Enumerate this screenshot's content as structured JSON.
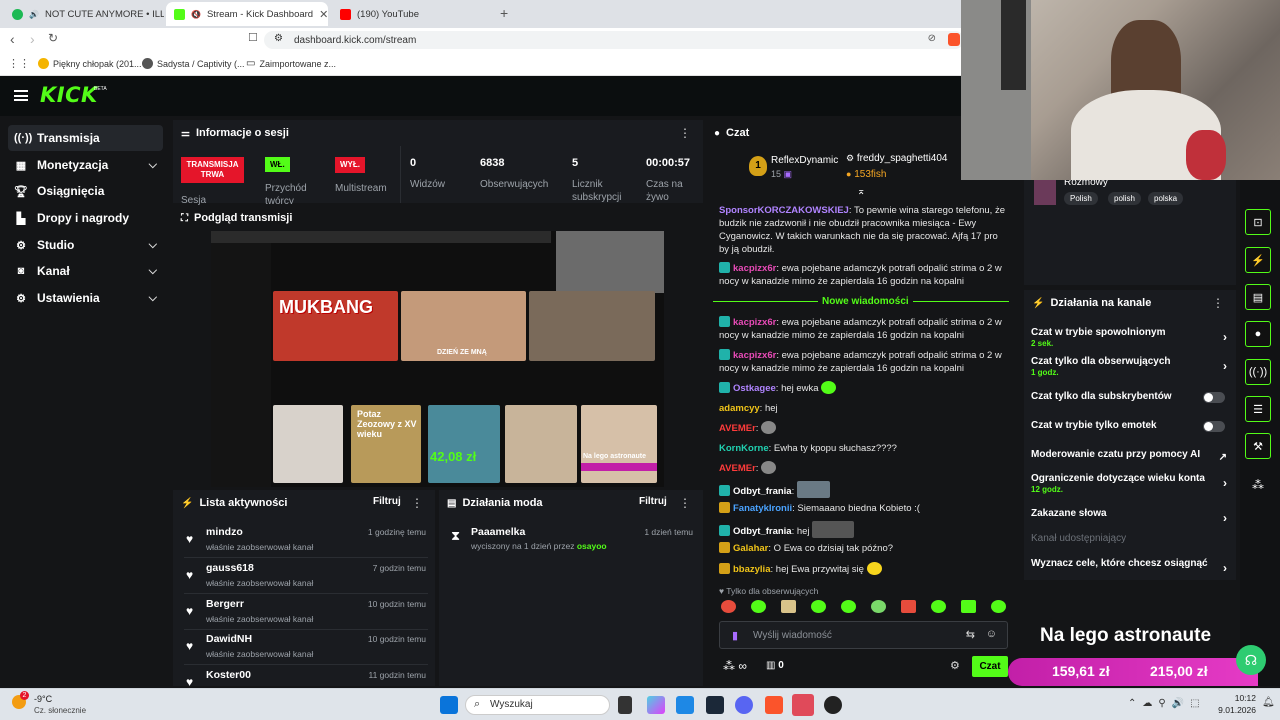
{
  "browser": {
    "tabs": [
      {
        "label": "NOT CUTE ANYMORE • ILLIT"
      },
      {
        "label": "Stream - Kick Dashboard"
      },
      {
        "label": "(190) YouTube"
      }
    ],
    "url": "dashboard.kick.com/stream",
    "bookmarks": [
      "Piękny chłopak (201...",
      "Sadysta / Captivity (...",
      "Zaimportowane z..."
    ]
  },
  "sidebar": {
    "items": [
      {
        "label": "Transmisja",
        "icon": "broadcast-icon",
        "chevron": false
      },
      {
        "label": "Monetyzacja",
        "icon": "dollar-icon",
        "chevron": true
      },
      {
        "label": "Osiągnięcia",
        "icon": "trophy-icon",
        "chevron": false
      },
      {
        "label": "Dropy i nagrody",
        "icon": "gift-icon",
        "chevron": false
      },
      {
        "label": "Studio",
        "icon": "gear-icon",
        "chevron": true
      },
      {
        "label": "Kanał",
        "icon": "channel-icon",
        "chevron": true
      },
      {
        "label": "Ustawienia",
        "icon": "settings-icon",
        "chevron": true
      }
    ]
  },
  "session": {
    "title": "Informacje o sesji",
    "badge_live": "TRANSMISJA TRWA",
    "label_session": "Sesja",
    "badge_on": "WŁ.",
    "label_transcode": "Przychód twórcy",
    "badge_off": "WYŁ.",
    "label_multistream": "Multistream",
    "viewers": "0",
    "label_viewers": "Widzów",
    "followers": "6838",
    "label_followers": "Obserwujących",
    "subs": "5",
    "label_subs": "Licznik subskrypcji",
    "uptime": "00:00:57",
    "label_uptime": "Czas na żywo"
  },
  "preview": {
    "title": "Podgląd transmisji",
    "overlay_price": "42,08 zł",
    "overlay_name": "Na lego astronaute",
    "thumb_text1": "MUKBANG",
    "thumb_text2": "DZIEŃ ZE MNĄ",
    "thumb_text3": "Potaz Zeozowy z XV wieku"
  },
  "activity": {
    "title": "Lista aktywności",
    "filter": "Filtruj",
    "rows": [
      {
        "name": "mindzo",
        "sub": "właśnie zaobserwował kanał",
        "time": "1 godzinę temu"
      },
      {
        "name": "gauss618",
        "sub": "właśnie zaobserwował kanał",
        "time": "7 godzin temu"
      },
      {
        "name": "Bergerr",
        "sub": "właśnie zaobserwował kanał",
        "time": "10 godzin temu"
      },
      {
        "name": "DawidNH",
        "sub": "właśnie zaobserwował kanał",
        "time": "10 godzin temu"
      },
      {
        "name": "Koster00",
        "sub": "",
        "time": "11 godzin temu"
      }
    ]
  },
  "modactions": {
    "title": "Działania moda",
    "filter": "Filtruj",
    "name": "Paaamelka",
    "time": "1 dzień temu",
    "sub_prefix": "wyciszony na 1 dzień przez",
    "by": "osayoo"
  },
  "chat": {
    "title": "Czat",
    "top_gifter1": "ReflexDynamic",
    "top_gifter1_count": "15",
    "top_gifter2": "freddy_spaghetti404",
    "top_gifter2_amount": "153fish",
    "rank": "1",
    "msg0_user": "SponsorKORCZAKOWSKIEJ",
    "msg0_text": "To pewnie wina starego telefonu, że budzik nie zadzwonił i nie obudził pracownika miesiąca - Ewy Cyganowicz. W takich warunkach nie da się pracować. Ajfą 17 pro by ją obudził.",
    "msg1_user": "kacpizx6r",
    "msg1_text": "ewa pojebane adamczyk potrafi odpalić strima o 2 w nocy w kanadzie mimo że zapierdala 16 godzin na kopalni",
    "new_messages": "Nowe wiadomości",
    "msg2_user": "kacpizx6r",
    "msg2_text": "ewa pojebane adamczyk potrafi odpalić strima o 2 w nocy w kanadzie mimo że zapierdala 16 godzin na kopalni",
    "msg3_user": "kacpizx6r",
    "msg3_text": "ewa pojebane adamczyk potrafi odpalić strima o 2 w nocy w kanadzie mimo że zapierdala 16 godzin na kopalni",
    "msg4_user": "Ostkagee",
    "msg4_text": "hej ewka",
    "msg5_user": "adamcyy",
    "msg5_text": "hej",
    "msg6_user": "AVEMEr",
    "msg7_user": "KornKorne",
    "msg7_text": "Ewha ty kpopu słuchasz????",
    "msg8_user": "AVEMEr",
    "msg9_user": "Odbyt_frania",
    "msg10_user": "FanatykIronii",
    "msg10_text": "Siemaaano biedna Kobieto :(",
    "msg11_user": "Odbyt_frania",
    "msg11_text": "hej",
    "msg12_user": "Galahar",
    "msg12_text": "O Ewa co dzisiaj tak późno?",
    "msg13_user": "bbazylia",
    "msg13_text": "hej Ewa przywitaj się",
    "followers_only": "Tylko dla obserwujących",
    "input_placeholder": "Wyślij wiadomość",
    "send": "Czat",
    "points": "0"
  },
  "stream_info": {
    "category": "Rozmowy",
    "tags": [
      "Polish",
      "polish",
      "polska"
    ]
  },
  "channel_actions": {
    "title": "Działania na kanale",
    "items": [
      {
        "label": "Czat w trybie spowolnionym",
        "sub": "2 sek.",
        "type": "arrow"
      },
      {
        "label": "Czat tylko dla obserwujących",
        "sub": "1 godz.",
        "type": "arrow"
      },
      {
        "label": "Czat tylko dla subskrybentów",
        "sub": "",
        "type": "toggle"
      },
      {
        "label": "Czat w trybie tylko emotek",
        "sub": "",
        "type": "toggle"
      },
      {
        "label": "Moderowanie czatu przy pomocy AI",
        "sub": "",
        "type": "external"
      },
      {
        "label": "Ograniczenie dotyczące wieku konta",
        "sub": "12 godz.",
        "type": "arrow"
      },
      {
        "label": "Zakazane słowa",
        "sub": "",
        "type": "arrow"
      },
      {
        "label": "Kanał udostępniający",
        "sub": "",
        "type": "disabled"
      },
      {
        "label": "Wyznacz cele, które chcesz osiągnąć",
        "sub": "",
        "type": "arrow"
      }
    ]
  },
  "overlay": {
    "title": "Na lego astronaute",
    "amount1": "159,61 zł",
    "amount2": "215,00 zł"
  },
  "taskbar": {
    "weather_temp": "-9°C",
    "weather_desc": "Cz. słonecznie",
    "search": "Wyszukaj",
    "time": "10:12",
    "date": "9.01.2026",
    "weather_badge": "2"
  }
}
